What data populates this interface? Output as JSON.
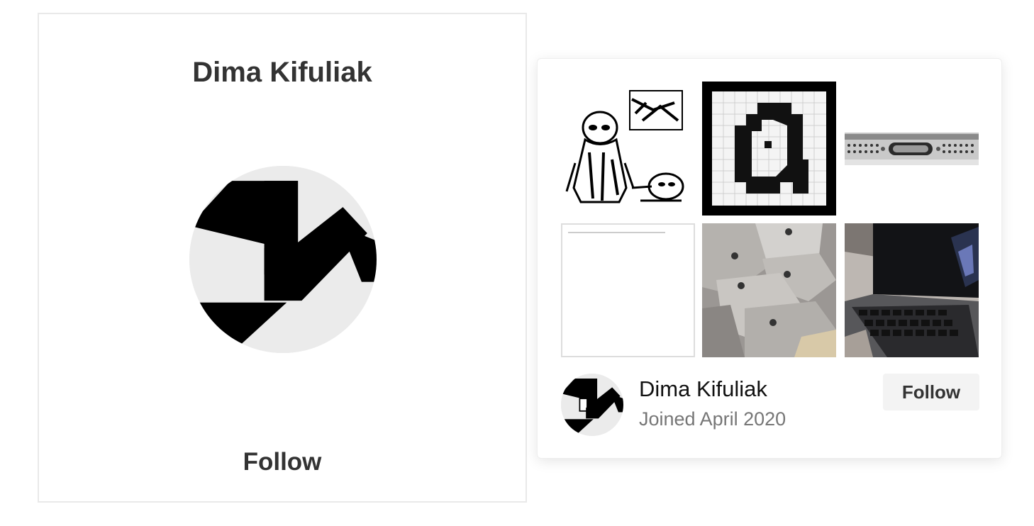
{
  "profile_card": {
    "name": "Dima Kifuliak",
    "follow_label": "Follow",
    "avatar_icon": "dk-monogram-logo"
  },
  "hover_card": {
    "gallery": [
      {
        "icon": "sketch-character-thumbnail"
      },
      {
        "icon": "pixel-letter-thumbnail"
      },
      {
        "icon": "phone-port-thumbnail"
      },
      {
        "icon": "blank-page-thumbnail"
      },
      {
        "icon": "macbooks-stack-thumbnail"
      },
      {
        "icon": "laptop-keyboard-thumbnail"
      }
    ],
    "name": "Dima Kifuliak",
    "joined": "Joined April 2020",
    "follow_label": "Follow"
  },
  "colors": {
    "text_dark": "#333333",
    "text_muted": "#767676",
    "button_bg": "#f3f3f3",
    "avatar_bg": "#ebebeb",
    "border": "#e9e9e9"
  }
}
